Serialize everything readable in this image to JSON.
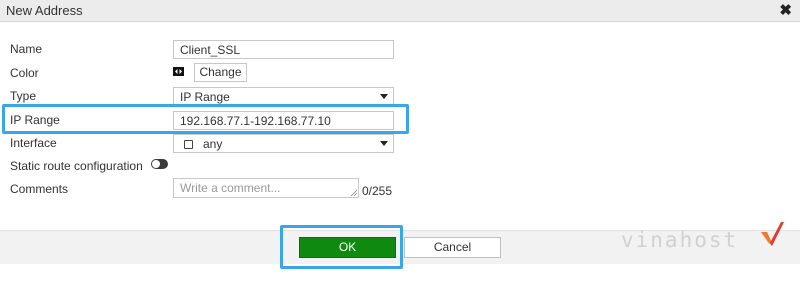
{
  "dialog": {
    "title": "New Address",
    "close_glyph": "✖"
  },
  "form": {
    "name": {
      "label": "Name",
      "value": "Client_SSL"
    },
    "color": {
      "label": "Color",
      "button_label": "Change",
      "icon": "color-swatch-icon"
    },
    "type": {
      "label": "Type",
      "value": "IP Range"
    },
    "ip_range": {
      "label": "IP Range",
      "value": "192.168.77.1-192.168.77.10"
    },
    "interface": {
      "label": "Interface",
      "value": "any",
      "icon": "interface-box-icon"
    },
    "static_route": {
      "label": "Static route configuration",
      "enabled": false
    },
    "comments": {
      "label": "Comments",
      "placeholder": "Write a comment...",
      "counter": "0/255"
    }
  },
  "footer": {
    "ok_label": "OK",
    "cancel_label": "Cancel"
  },
  "watermark": {
    "text": "vinahost",
    "mark": "checkmark-logo"
  },
  "colors": {
    "ok_green": "#108910",
    "highlight_blue": "#3aa6e8",
    "titlebar_bg": "#ececec",
    "footer_bg": "#f2f2f2"
  }
}
